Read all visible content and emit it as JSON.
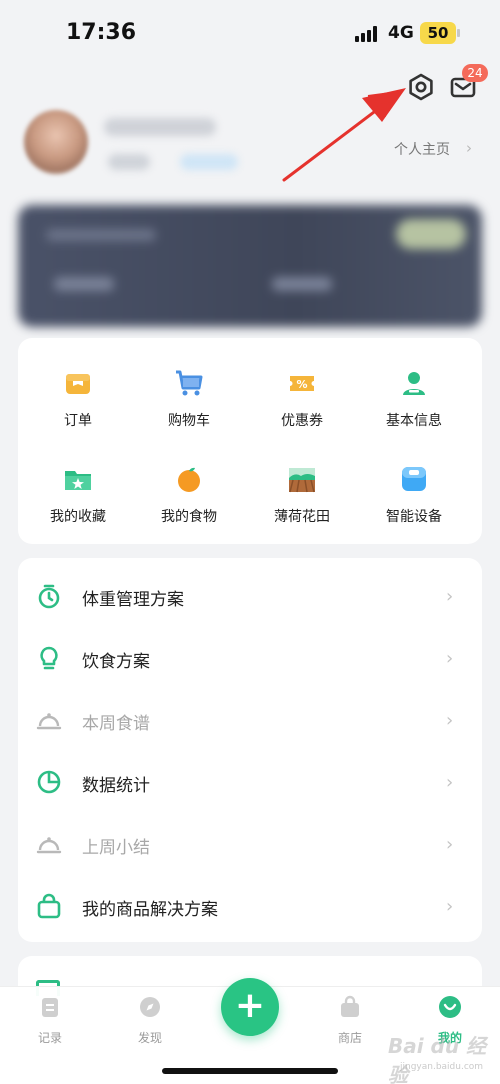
{
  "status_bar": {
    "time": "17:36",
    "network": "4G",
    "battery": "50"
  },
  "header": {
    "settings_icon": "gear-icon",
    "mail_icon": "mail-icon",
    "mail_badge": "24"
  },
  "profile": {
    "homepage_label": "个人主页",
    "chevron": "›"
  },
  "grid": {
    "items": [
      {
        "label": "订单",
        "icon": "order-icon"
      },
      {
        "label": "购物车",
        "icon": "cart-icon"
      },
      {
        "label": "优惠券",
        "icon": "coupon-icon"
      },
      {
        "label": "基本信息",
        "icon": "profile-info-icon"
      },
      {
        "label": "我的收藏",
        "icon": "favorites-folder-icon"
      },
      {
        "label": "我的食物",
        "icon": "orange-icon"
      },
      {
        "label": "薄荷花田",
        "icon": "field-icon"
      },
      {
        "label": "智能设备",
        "icon": "scale-device-icon"
      }
    ]
  },
  "menu": {
    "chevron": "›",
    "items": [
      {
        "label": "体重管理方案",
        "icon": "timer-icon",
        "muted": false
      },
      {
        "label": "饮食方案",
        "icon": "lightbulb-icon",
        "muted": false
      },
      {
        "label": "本周食谱",
        "icon": "dish-cover-icon",
        "muted": true
      },
      {
        "label": "数据统计",
        "icon": "pie-chart-icon",
        "muted": false
      },
      {
        "label": "上周小结",
        "icon": "dish-cover-icon",
        "muted": true
      },
      {
        "label": "我的商品解决方案",
        "icon": "shopping-bag-icon",
        "muted": false
      }
    ]
  },
  "tabbar": {
    "tabs": [
      {
        "label": "记录",
        "icon": "record-icon",
        "active": false
      },
      {
        "label": "发现",
        "icon": "discover-icon",
        "active": false
      },
      {
        "label": "商店",
        "icon": "shop-icon",
        "active": false
      },
      {
        "label": "我的",
        "icon": "me-icon",
        "active": true
      }
    ],
    "fab_symbol": "+"
  },
  "watermark": {
    "text": "Bai du 经验",
    "sub": "jingyan.baidu.com"
  },
  "colors": {
    "accent": "#2dbd85",
    "badge": "#f46a5a",
    "annotation": "#e5322d"
  }
}
